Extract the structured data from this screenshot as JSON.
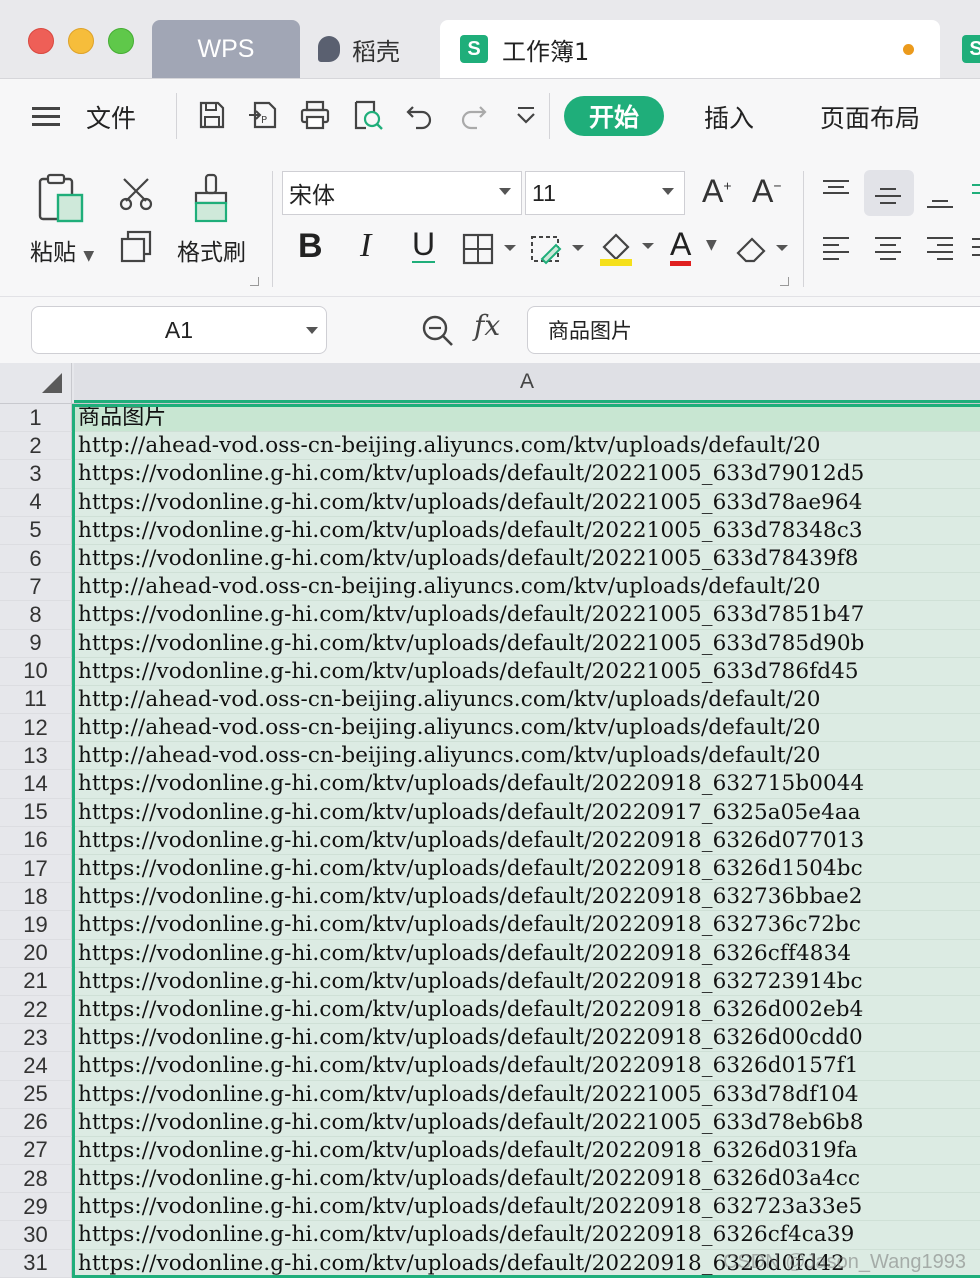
{
  "tabs": {
    "wps": "WPS",
    "daoke": "稻壳",
    "workbook": "工作簿1",
    "sheet_badge": "S"
  },
  "menu": {
    "file": "文件",
    "home": "开始",
    "insert": "插入",
    "page_layout": "页面布局"
  },
  "ribbon": {
    "paste": "粘贴",
    "format_painter": "格式刷",
    "font_name": "宋体",
    "font_size": "11",
    "bold": "B",
    "italic": "I",
    "underline": "U",
    "grow_font": "A",
    "shrink_font": "A",
    "font_color_letter": "A",
    "accent_color": "#1fae7a",
    "font_color": "#e02020",
    "highlight_color": "#f5e01b"
  },
  "formula_bar": {
    "name_box": "A1",
    "fx": "fx",
    "content": "商品图片"
  },
  "grid": {
    "column_header": "A",
    "rows": [
      {
        "n": "1",
        "v": "商品图片"
      },
      {
        "n": "2",
        "v": "http://ahead-vod.oss-cn-beijing.aliyuncs.com/ktv/uploads/default/20"
      },
      {
        "n": "3",
        "v": "https://vodonline.g-hi.com/ktv/uploads/default/20221005_633d79012d5"
      },
      {
        "n": "4",
        "v": "https://vodonline.g-hi.com/ktv/uploads/default/20221005_633d78ae964"
      },
      {
        "n": "5",
        "v": "https://vodonline.g-hi.com/ktv/uploads/default/20221005_633d78348c3"
      },
      {
        "n": "6",
        "v": "https://vodonline.g-hi.com/ktv/uploads/default/20221005_633d78439f8"
      },
      {
        "n": "7",
        "v": "http://ahead-vod.oss-cn-beijing.aliyuncs.com/ktv/uploads/default/20"
      },
      {
        "n": "8",
        "v": "https://vodonline.g-hi.com/ktv/uploads/default/20221005_633d7851b47"
      },
      {
        "n": "9",
        "v": "https://vodonline.g-hi.com/ktv/uploads/default/20221005_633d785d90b"
      },
      {
        "n": "10",
        "v": "https://vodonline.g-hi.com/ktv/uploads/default/20221005_633d786fd45"
      },
      {
        "n": "11",
        "v": "http://ahead-vod.oss-cn-beijing.aliyuncs.com/ktv/uploads/default/20"
      },
      {
        "n": "12",
        "v": "http://ahead-vod.oss-cn-beijing.aliyuncs.com/ktv/uploads/default/20"
      },
      {
        "n": "13",
        "v": "http://ahead-vod.oss-cn-beijing.aliyuncs.com/ktv/uploads/default/20"
      },
      {
        "n": "14",
        "v": "https://vodonline.g-hi.com/ktv/uploads/default/20220918_632715b0044"
      },
      {
        "n": "15",
        "v": "https://vodonline.g-hi.com/ktv/uploads/default/20220917_6325a05e4aa"
      },
      {
        "n": "16",
        "v": "https://vodonline.g-hi.com/ktv/uploads/default/20220918_6326d077013"
      },
      {
        "n": "17",
        "v": "https://vodonline.g-hi.com/ktv/uploads/default/20220918_6326d1504bc"
      },
      {
        "n": "18",
        "v": "https://vodonline.g-hi.com/ktv/uploads/default/20220918_632736bbae2"
      },
      {
        "n": "19",
        "v": "https://vodonline.g-hi.com/ktv/uploads/default/20220918_632736c72bc"
      },
      {
        "n": "20",
        "v": "https://vodonline.g-hi.com/ktv/uploads/default/20220918_6326cff4834"
      },
      {
        "n": "21",
        "v": "https://vodonline.g-hi.com/ktv/uploads/default/20220918_632723914bc"
      },
      {
        "n": "22",
        "v": "https://vodonline.g-hi.com/ktv/uploads/default/20220918_6326d002eb4"
      },
      {
        "n": "23",
        "v": "https://vodonline.g-hi.com/ktv/uploads/default/20220918_6326d00cdd0"
      },
      {
        "n": "24",
        "v": "https://vodonline.g-hi.com/ktv/uploads/default/20220918_6326d0157f1"
      },
      {
        "n": "25",
        "v": "https://vodonline.g-hi.com/ktv/uploads/default/20221005_633d78df104"
      },
      {
        "n": "26",
        "v": "https://vodonline.g-hi.com/ktv/uploads/default/20221005_633d78eb6b8"
      },
      {
        "n": "27",
        "v": "https://vodonline.g-hi.com/ktv/uploads/default/20220918_6326d0319fa"
      },
      {
        "n": "28",
        "v": "https://vodonline.g-hi.com/ktv/uploads/default/20220918_6326d03a4cc"
      },
      {
        "n": "29",
        "v": "https://vodonline.g-hi.com/ktv/uploads/default/20220918_632723a33e5"
      },
      {
        "n": "30",
        "v": "https://vodonline.g-hi.com/ktv/uploads/default/20220918_6326cf4ca39"
      },
      {
        "n": "31",
        "v": "https://vodonline.g-hi.com/ktv/uploads/default/20220918_6326d0fd42"
      }
    ]
  },
  "watermark": "CSDN @Jason_Wang1993"
}
